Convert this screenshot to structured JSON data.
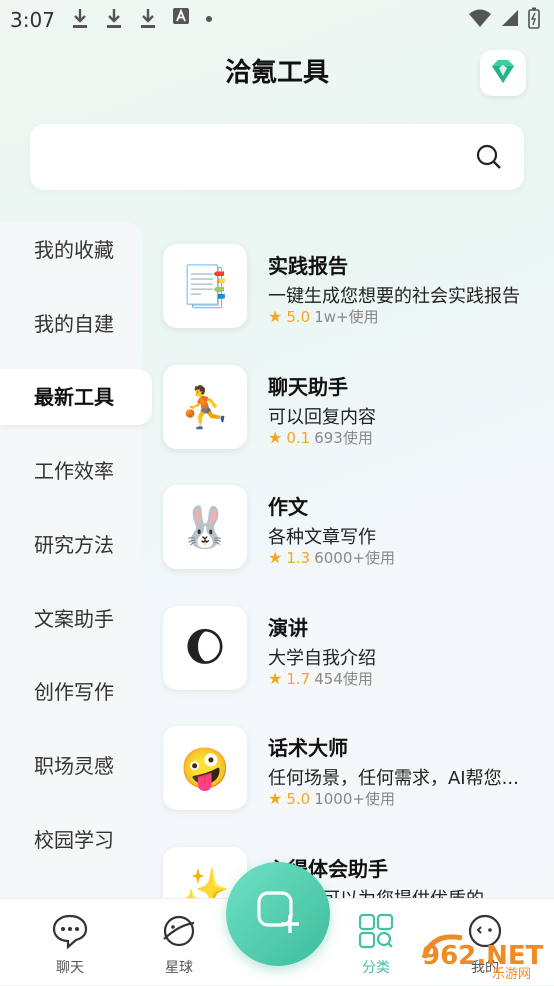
{
  "status_bar": {
    "time": "3:07"
  },
  "header": {
    "title": "洽氪工具"
  },
  "search": {
    "placeholder": ""
  },
  "sidebar": {
    "items": [
      {
        "label": "我的收藏",
        "active": false
      },
      {
        "label": "我的自建",
        "active": false
      },
      {
        "label": "最新工具",
        "active": true
      },
      {
        "label": "工作效率",
        "active": false
      },
      {
        "label": "研究方法",
        "active": false
      },
      {
        "label": "文案助手",
        "active": false
      },
      {
        "label": "创作写作",
        "active": false
      },
      {
        "label": "职场灵感",
        "active": false
      },
      {
        "label": "校园学习",
        "active": false
      }
    ]
  },
  "tools": [
    {
      "name": "实践报告",
      "desc": "一键生成您想要的社会实践报告",
      "rating": "5.0",
      "usage": "1w+使用",
      "icon": "📑"
    },
    {
      "name": "聊天助手",
      "desc": "可以回复内容",
      "rating": "0.1",
      "usage": "693使用",
      "icon": "⛹️"
    },
    {
      "name": "作文",
      "desc": "各种文章写作",
      "rating": "1.3",
      "usage": "6000+使用",
      "icon": "🐰"
    },
    {
      "name": "演讲",
      "desc": "大学自我介绍",
      "rating": "1.7",
      "usage": "454使用",
      "icon": "🌔"
    },
    {
      "name": "话术大师",
      "desc": "任何场景，任何需求，AI帮您...",
      "rating": "5.0",
      "usage": "1000+使用",
      "icon": "🤪"
    },
    {
      "name": "心得体会助手",
      "desc": "该工具可以为您提供优质的",
      "rating": "",
      "usage": "",
      "icon": "✨"
    }
  ],
  "bottom_nav": {
    "items": [
      {
        "label": "聊天",
        "icon": "chat-icon",
        "active": false
      },
      {
        "label": "星球",
        "icon": "planet-icon",
        "active": false
      },
      {
        "label": "分类",
        "icon": "category-icon",
        "active": true
      },
      {
        "label": "我的",
        "icon": "profile-icon",
        "active": false
      }
    ]
  },
  "watermark": {
    "text": "962.NET",
    "subtext": "乐游网"
  },
  "colors": {
    "accent": "#42c2a1",
    "star": "#f5a623"
  }
}
